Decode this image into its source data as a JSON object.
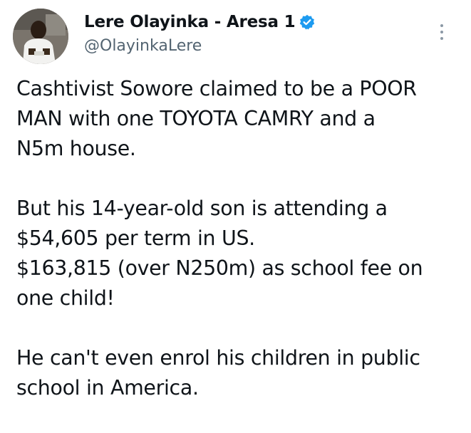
{
  "tweet": {
    "author": {
      "display_name": "Lere Olayinka - Aresa 1",
      "handle": "@OlayinkaLere",
      "verified": true,
      "avatar": "profile-photo"
    },
    "more_icon": "more-options-vertical-icon",
    "paragraphs": [
      {
        "lines": [
          "Cashtivist Sowore claimed to be a POOR",
          "MAN with one TOYOTA CAMRY and a",
          "N5m house."
        ]
      },
      {
        "lines": [
          "But his 14-year-old son is attending a",
          "$54,605 per term in US.",
          "$163,815 (over N250m) as school fee on",
          "one child!"
        ]
      },
      {
        "lines": [
          "He can't even enrol his children in public",
          "school in America."
        ]
      }
    ]
  },
  "colors": {
    "text": "#0f1419",
    "secondary_text": "#536471",
    "verified_badge": "#1d9bf0",
    "background": "#ffffff"
  }
}
